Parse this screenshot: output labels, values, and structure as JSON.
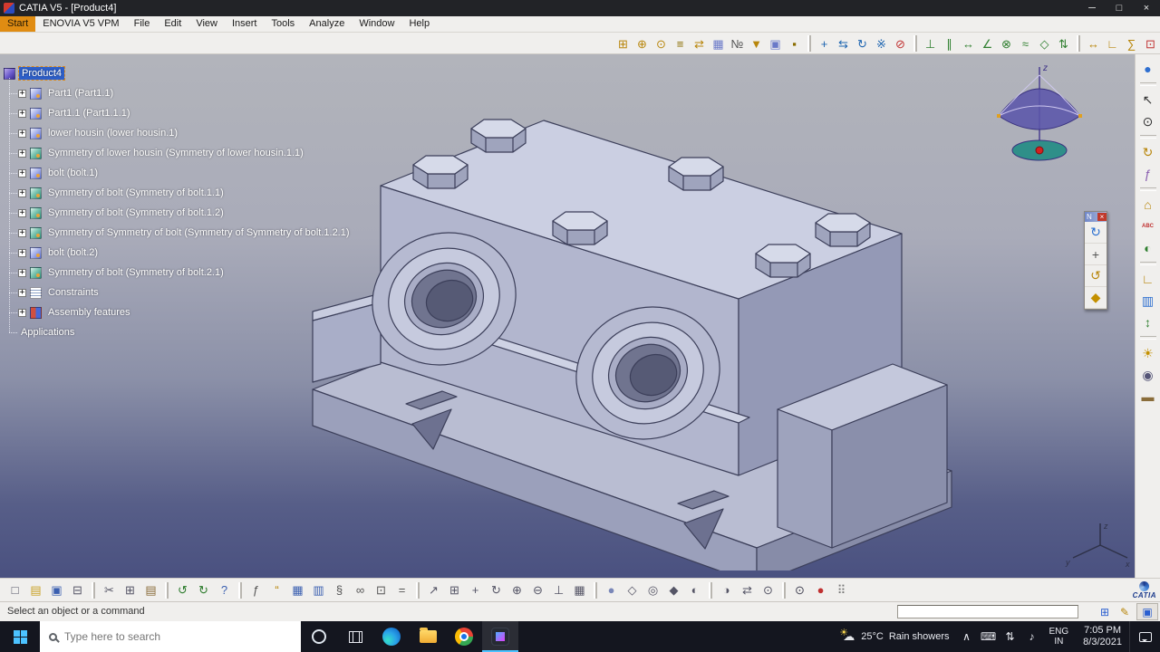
{
  "titlebar": {
    "title": "CATIA V5 - [Product4]",
    "minimize": "─",
    "maximize": "□",
    "close": "×"
  },
  "menubar": {
    "items": [
      {
        "label": "Start",
        "highlighted": true
      },
      {
        "label": "ENOVIA V5 VPM"
      },
      {
        "label": "File"
      },
      {
        "label": "Edit"
      },
      {
        "label": "View"
      },
      {
        "label": "Insert"
      },
      {
        "label": "Tools"
      },
      {
        "label": "Analyze"
      },
      {
        "label": "Window"
      },
      {
        "label": "Help"
      }
    ]
  },
  "top_toolbar": {
    "groups": [
      [
        {
          "name": "component-icon",
          "glyph": "⊞",
          "color": "#b8860b"
        },
        {
          "name": "product-icon",
          "glyph": "⊕",
          "color": "#b8860b"
        },
        {
          "name": "part-icon",
          "glyph": "⊙",
          "color": "#b8860b"
        },
        {
          "name": "reuse-pattern-icon",
          "glyph": "≡",
          "color": "#8a6d00"
        },
        {
          "name": "multi-instantiation-icon",
          "glyph": "⇄",
          "color": "#b8860b"
        },
        {
          "name": "graph-tree-reordering-icon",
          "glyph": "▦",
          "color": "#6a79c8"
        },
        {
          "name": "generate-numbering-icon",
          "glyph": "№",
          "color": "#555555"
        },
        {
          "name": "selective-load-icon",
          "glyph": "▼",
          "color": "#b8860b"
        },
        {
          "name": "manage-representations-icon",
          "glyph": "▣",
          "color": "#6a79c8"
        },
        {
          "name": "fast-multi-instantiation-icon",
          "glyph": "▪",
          "color": "#8a6d00"
        }
      ],
      [
        {
          "name": "manipulation-icon",
          "glyph": "+",
          "color": "#1c64b0"
        },
        {
          "name": "snap-icon",
          "glyph": "⇆",
          "color": "#1c64b0"
        },
        {
          "name": "smart-move-icon",
          "glyph": "↻",
          "color": "#1c64b0"
        },
        {
          "name": "explode-icon",
          "glyph": "※",
          "color": "#1c64b0"
        },
        {
          "name": "clash-stop-icon",
          "glyph": "⊘",
          "color": "#c03030"
        }
      ],
      [
        {
          "name": "coincidence-constraint-icon",
          "glyph": "⊥",
          "color": "#2f7f2f"
        },
        {
          "name": "contact-constraint-icon",
          "glyph": "∥",
          "color": "#2f7f2f"
        },
        {
          "name": "offset-constraint-icon",
          "glyph": "↔",
          "color": "#2f7f2f"
        },
        {
          "name": "angle-constraint-icon",
          "glyph": "∠",
          "color": "#2f7f2f"
        },
        {
          "name": "fix-component-icon",
          "glyph": "⊗",
          "color": "#2f7f2f"
        },
        {
          "name": "quick-constraint-icon",
          "glyph": "≈",
          "color": "#2f7f2f"
        },
        {
          "name": "flexible-rigid-icon",
          "glyph": "◇",
          "color": "#2f7f2f"
        },
        {
          "name": "change-constraint-icon",
          "glyph": "⇅",
          "color": "#2f7f2f"
        }
      ],
      [
        {
          "name": "measure-between-icon",
          "glyph": "↔",
          "color": "#b8860b"
        },
        {
          "name": "measure-item-icon",
          "glyph": "∟",
          "color": "#b8860b"
        },
        {
          "name": "measure-inertia-icon",
          "glyph": "∑",
          "color": "#b8860b"
        },
        {
          "name": "clash-analysis-icon",
          "glyph": "⊡",
          "color": "#c03030"
        },
        {
          "name": "annotations-icon",
          "glyph": "✎",
          "color": "#445588"
        }
      ]
    ]
  },
  "tree": {
    "items": [
      {
        "label": "Product4",
        "icon": "product",
        "expander": false,
        "selected": true
      },
      {
        "label": "Part1 (Part1.1)",
        "icon": "part",
        "expander": true
      },
      {
        "label": "Part1.1 (Part1.1.1)",
        "icon": "part",
        "expander": true
      },
      {
        "label": "lower housin (lower housin.1)",
        "icon": "part",
        "expander": true
      },
      {
        "label": "Symmetry of lower housin (Symmetry of lower housin.1.1)",
        "icon": "symmetry",
        "expander": true
      },
      {
        "label": "bolt (bolt.1)",
        "icon": "part",
        "expander": true
      },
      {
        "label": "Symmetry of bolt (Symmetry of bolt.1.1)",
        "icon": "symmetry",
        "expander": true
      },
      {
        "label": "Symmetry of bolt (Symmetry of bolt.1.2)",
        "icon": "symmetry",
        "expander": true
      },
      {
        "label": "Symmetry of Symmetry of bolt (Symmetry of Symmetry of bolt.1.2.1)",
        "icon": "symmetry",
        "expander": true
      },
      {
        "label": "bolt (bolt.2)",
        "icon": "part",
        "expander": true
      },
      {
        "label": "Symmetry of bolt (Symmetry of bolt.2.1)",
        "icon": "symmetry",
        "expander": true
      },
      {
        "label": "Constraints",
        "icon": "constraints",
        "expander": true
      },
      {
        "label": "Assembly features",
        "icon": "assembly",
        "expander": true
      },
      {
        "label": "Applications",
        "icon": null,
        "expander": false
      }
    ]
  },
  "floating_toolbar": {
    "title": "N",
    "close_glyph": "×",
    "icons": [
      {
        "name": "update-all-icon",
        "glyph": "↻",
        "color": "#2a6fd0"
      },
      {
        "name": "manipulation-icon",
        "glyph": "+",
        "color": "#555555"
      },
      {
        "name": "smart-update-icon",
        "glyph": "↺",
        "color": "#b8860b"
      },
      {
        "name": "constraint-creation-icon",
        "glyph": "◆",
        "color": "#c49000"
      }
    ]
  },
  "viewport": {
    "compass_z": "z",
    "triad_x": "x",
    "triad_y": "y",
    "triad_z": "z"
  },
  "right_toolbar": {
    "icons": [
      {
        "name": "sphere-render-icon",
        "glyph": "●",
        "color": "#2e6fd0"
      },
      {
        "sep": true
      },
      {
        "name": "select-icon",
        "glyph": "↖",
        "color": "#333333"
      },
      {
        "name": "look-at-icon",
        "glyph": "⊙",
        "color": "#333333"
      },
      {
        "sep": true
      },
      {
        "name": "update-icon",
        "glyph": "↻",
        "color": "#b8860b"
      },
      {
        "name": "knowledge-icon",
        "glyph": "ƒ",
        "color": "#8a5fb0"
      },
      {
        "sep": true
      },
      {
        "name": "catalog-browser-icon",
        "glyph": "⌂",
        "color": "#b8860b"
      },
      {
        "name": "abc-annotation-icon",
        "glyph": "ABC",
        "color": "#c03030",
        "small": true
      },
      {
        "name": "apply-material-icon",
        "glyph": "◐",
        "color": "#2f7f2f"
      },
      {
        "sep": true
      },
      {
        "name": "measure-icon",
        "glyph": "∟",
        "color": "#b8860b"
      },
      {
        "name": "sectioning-icon",
        "glyph": "▥",
        "color": "#2e6fd0"
      },
      {
        "name": "distance-analysis-icon",
        "glyph": "↕",
        "color": "#2f7f2f"
      },
      {
        "sep": true
      },
      {
        "name": "light-icon",
        "glyph": "☀",
        "color": "#c49000"
      },
      {
        "name": "depth-effect-icon",
        "glyph": "◉",
        "color": "#555577"
      },
      {
        "name": "ground-icon",
        "glyph": "▬",
        "color": "#8a6d3b"
      }
    ]
  },
  "bottom_toolbar": {
    "logo_text": "CATIA",
    "groups": [
      [
        {
          "name": "new-file-icon",
          "glyph": "□",
          "color": "#556"
        },
        {
          "name": "open-folder-icon",
          "glyph": "▤",
          "color": "#c9a227"
        },
        {
          "name": "save-icon",
          "glyph": "▣",
          "color": "#3a5fb0"
        },
        {
          "name": "print-icon",
          "glyph": "⊟",
          "color": "#556"
        }
      ],
      [
        {
          "name": "cut-icon",
          "glyph": "✂",
          "color": "#556"
        },
        {
          "name": "copy-icon",
          "glyph": "⊞",
          "color": "#556"
        },
        {
          "name": "paste-icon",
          "glyph": "▤",
          "color": "#8a6d3b"
        }
      ],
      [
        {
          "name": "undo-icon",
          "glyph": "↺",
          "color": "#2a7a2a"
        },
        {
          "name": "redo-icon",
          "glyph": "↻",
          "color": "#2a7a2a"
        },
        {
          "name": "whats-this-icon",
          "glyph": "?",
          "color": "#3a5fb0"
        }
      ],
      [
        {
          "name": "formula-icon",
          "glyph": "ƒ",
          "color": "#555555"
        },
        {
          "name": "comment-icon",
          "glyph": "“",
          "color": "#b8860b"
        },
        {
          "name": "table-icon",
          "glyph": "▦",
          "color": "#3a5fb0"
        },
        {
          "name": "chart-icon",
          "glyph": "▥",
          "color": "#3a5fb0"
        },
        {
          "name": "script-icon",
          "glyph": "§",
          "color": "#555555"
        },
        {
          "name": "link-icon",
          "glyph": "∞",
          "color": "#555555"
        },
        {
          "name": "lock-icon",
          "glyph": "⊡",
          "color": "#555555"
        },
        {
          "name": "equivalent-dimensions-icon",
          "glyph": "=",
          "color": "#555555"
        }
      ],
      [
        {
          "name": "fly-mode-icon",
          "glyph": "↗",
          "color": "#556"
        },
        {
          "name": "fit-all-in-icon",
          "glyph": "⊞",
          "color": "#556"
        },
        {
          "name": "pan-icon",
          "glyph": "+",
          "color": "#556"
        },
        {
          "name": "rotate-view-icon",
          "glyph": "↻",
          "color": "#556"
        },
        {
          "name": "zoom-in-icon",
          "glyph": "⊕",
          "color": "#556"
        },
        {
          "name": "zoom-out-icon",
          "glyph": "⊖",
          "color": "#556"
        },
        {
          "name": "normal-view-icon",
          "glyph": "⊥",
          "color": "#556"
        },
        {
          "name": "multi-view-icon",
          "glyph": "▦",
          "color": "#556"
        }
      ],
      [
        {
          "name": "shaded-view-icon",
          "glyph": "●",
          "color": "#7a87b8"
        },
        {
          "name": "wireframe-view-icon",
          "glyph": "◇",
          "color": "#556"
        },
        {
          "name": "hidden-line-icon",
          "glyph": "◎",
          "color": "#556"
        },
        {
          "name": "perspective-icon",
          "glyph": "◆",
          "color": "#556"
        },
        {
          "name": "depth-view-icon",
          "glyph": "◐",
          "color": "#556"
        }
      ],
      [
        {
          "name": "hide-show-icon",
          "glyph": "◑",
          "color": "#556"
        },
        {
          "name": "swap-visible-space-icon",
          "glyph": "⇄",
          "color": "#556"
        },
        {
          "name": "magnifier-icon",
          "glyph": "⊙",
          "color": "#556"
        }
      ],
      [
        {
          "name": "camera-icon",
          "glyph": "⊙",
          "color": "#445"
        },
        {
          "name": "record-icon",
          "glyph": "●",
          "color": "#c03030"
        },
        {
          "name": "customize-dots-icon",
          "glyph": "⠿",
          "color": "#777777"
        }
      ]
    ]
  },
  "status_bar": {
    "message": "Select an object or a command",
    "corner_glyph": "▣",
    "icons": [
      {
        "name": "knowledge-status-icon",
        "glyph": "⊞",
        "color": "#2a5fd0"
      },
      {
        "name": "pencil-status-icon",
        "glyph": "✎",
        "color": "#b8860b"
      }
    ]
  },
  "taskbar": {
    "search_placeholder": "Type here to search",
    "weather_temp": "25°C",
    "weather_desc": "Rain showers",
    "tray_chevron": "∧",
    "lang_line1": "ENG",
    "lang_line2": "IN",
    "time": "7:05 PM",
    "date": "8/3/2021"
  },
  "colors": {
    "viewport_top": "#b2b4bb",
    "viewport_bottom": "#4a5180",
    "model_fill": "#b2b6ce",
    "model_edge": "#3c3f5a",
    "selection_blue": "#2e5fc8",
    "start_tab_orange": "#e08a12",
    "taskbar_bg": "#14161f"
  }
}
